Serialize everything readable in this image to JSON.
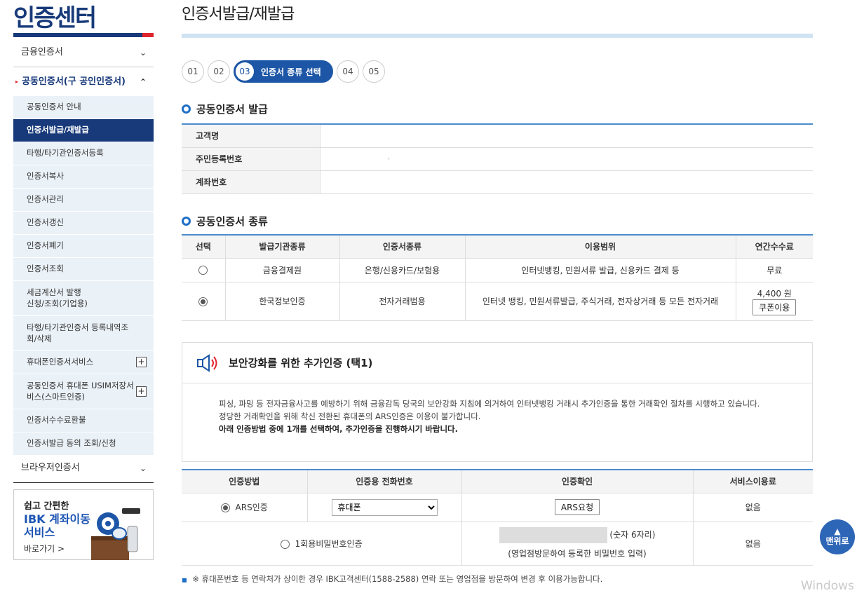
{
  "sidebar": {
    "center_title": "인증센터",
    "top_items": [
      {
        "label": "금융인증서",
        "chevron": "chevron-down"
      },
      {
        "label": "공동인증서(구 공인인증서)",
        "chevron": "chevron-up"
      },
      {
        "label": "브라우저인증서",
        "chevron": "chevron-down"
      }
    ],
    "sub_items": [
      {
        "label": "공동인증서 안내"
      },
      {
        "label": "인증서발급/재발급",
        "active": true
      },
      {
        "label": "타행/타기관인증서등록"
      },
      {
        "label": "인증서복사"
      },
      {
        "label": "인증서관리"
      },
      {
        "label": "인증서갱신"
      },
      {
        "label": "인증서폐기"
      },
      {
        "label": "인증서조회"
      },
      {
        "label": "세금계산서 발행\n신청/조회(기업용)"
      },
      {
        "label": "타행/타기관인증서 등록내역조\n회/삭제"
      },
      {
        "label": "휴대폰인증서서비스",
        "expandable": true
      },
      {
        "label": "공동인증서 휴대폰 USIM저장서\n비스(스마트인증)",
        "expandable": true
      },
      {
        "label": "인증서수수료환불"
      },
      {
        "label": "인증서발급 동의 조회/신청"
      }
    ],
    "promo": {
      "line1": "쉽고 간편한",
      "line2": "IBK 계좌이동 서비스",
      "link": "바로가기 >"
    }
  },
  "main": {
    "title": "인증서발급/재발급",
    "steps": [
      "01",
      "02",
      "03",
      "04",
      "05"
    ],
    "active_step_label": "인증서 종류 선택",
    "section1": {
      "title": "공동인증서 발급",
      "rows": [
        {
          "label": "고객명",
          "value": ""
        },
        {
          "label": "주민등록번호",
          "value": "-"
        },
        {
          "label": "계좌번호",
          "value": ""
        }
      ]
    },
    "section2": {
      "title": "공동인증서 종류",
      "headers": [
        "선택",
        "발급기관종류",
        "인증서종류",
        "이용범위",
        "연간수수료"
      ],
      "rows": [
        {
          "selected": false,
          "issuer": "금융결제원",
          "type": "은행/신용카드/보험용",
          "scope": "인터넷뱅킹, 민원서류 발급, 신용카드 결제 등",
          "fee": "무료"
        },
        {
          "selected": true,
          "issuer": "한국정보인증",
          "type": "전자거래범용",
          "scope": "인터넷 뱅킹, 민원서류발급, 주식거래, 전자상거래 등 모든 전자거래",
          "fee": "4,400 원",
          "coupon": "쿠폰이용"
        }
      ]
    },
    "notice": {
      "icon": "speaker-icon",
      "title": "보안강화를 위한 추가인증 (택1)",
      "line1": "피싱, 파밍 등 전자금융사고를 예방하기 위해 금융감독 당국의 보안강화 지침에 의거하여 인터넷뱅킹 거래시 추가인증을 통한 거래확인 절차를 시행하고 있습니다.",
      "line2": "정당한 거래확인을 위해 착신 전환된 휴대폰의 ARS인증은 이용이 불가합니다.",
      "line3": "아래 인증방법 중에 1개를 선택하여, 추가인증을 진행하시기 바랍니다."
    },
    "auth": {
      "headers": [
        "인증방법",
        "인증용 전화번호",
        "인증확인",
        "서비스이용료"
      ],
      "ars": {
        "label": "ARS인증",
        "phone_value": "휴대폰",
        "button": "ARS요청",
        "fee": "없음"
      },
      "otp": {
        "label": "1회용비밀번호인증",
        "digits": "(숫자 6자리)",
        "hint": "(영업점방문하여 등록한 비밀번호 입력)",
        "fee": "없음"
      }
    },
    "footnote": "※ 휴대폰번호 등 연락처가 상이한 경우 IBK고객센터(1588-2588) 연락 또는 영업점을 방문하여 변경 후 이용가능합니다."
  },
  "top_button": {
    "label": "맨위로"
  },
  "watermark": "Windows",
  "colors": {
    "brand_navy": "#183a7a",
    "accent_blue": "#1d56a6",
    "accent_red": "#e0242c",
    "light_bg": "#eaf1f7"
  }
}
